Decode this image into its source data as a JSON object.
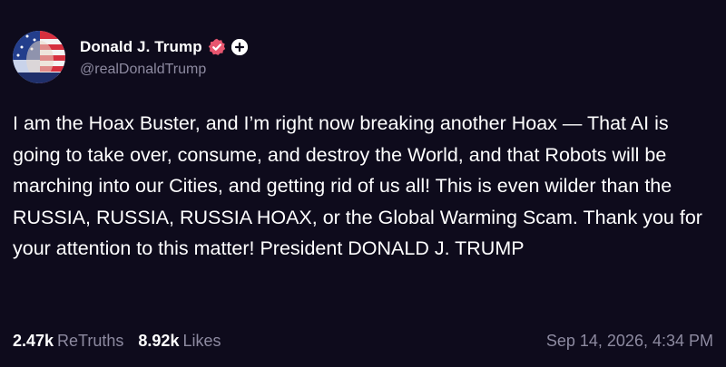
{
  "author": {
    "display_name": "Donald J. Trump",
    "handle": "@realDonaldTrump",
    "verified_icon": "verified-badge-icon",
    "plus_icon": "plus-badge-icon"
  },
  "post": {
    "text": "I am the Hoax Buster, and I’m right now breaking another Hoax — That AI is going to take over, consume, and destroy the World, and that Robots will be marching into our Cities, and getting rid of us all! This is even wilder than the RUSSIA, RUSSIA, RUSSIA HOAX, or the Global Warming Scam. Thank you for your attention to this matter! President DONALD J. TRUMP"
  },
  "stats": {
    "retruths_count": "2.47k",
    "retruths_label": "ReTruths",
    "likes_count": "8.92k",
    "likes_label": "Likes"
  },
  "timestamp": "Sep 14, 2026, 4:34 PM",
  "colors": {
    "background": "#0e0b1c",
    "text": "#ffffff",
    "muted": "#8d8aa0",
    "verified": "#e8566f"
  }
}
